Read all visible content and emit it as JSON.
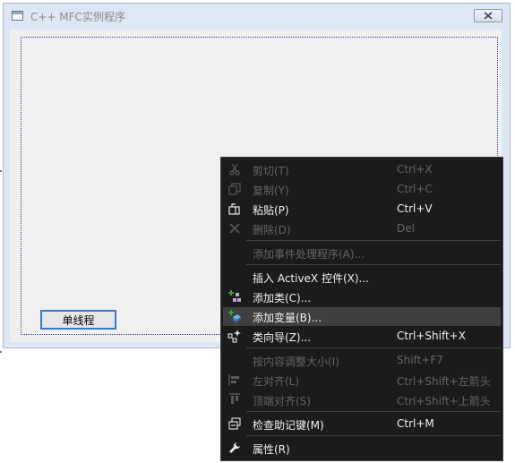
{
  "dialog": {
    "title": "C++ MFC实例程序",
    "button_label": "单线程"
  },
  "menu": {
    "items": [
      {
        "label": "剪切(T)",
        "shortcut": "Ctrl+X",
        "enabled": false,
        "icon": "scissors-icon"
      },
      {
        "label": "复制(Y)",
        "shortcut": "Ctrl+C",
        "enabled": false,
        "icon": "copy-icon"
      },
      {
        "label": "粘贴(P)",
        "shortcut": "Ctrl+V",
        "enabled": true,
        "icon": "paste-icon"
      },
      {
        "label": "删除(D)",
        "shortcut": "Del",
        "enabled": false,
        "icon": "delete-icon"
      },
      {
        "label": "添加事件处理程序(A)...",
        "shortcut": "",
        "enabled": false,
        "icon": ""
      },
      {
        "label": "插入 ActiveX 控件(X)...",
        "shortcut": "",
        "enabled": true,
        "icon": ""
      },
      {
        "label": "添加类(C)...",
        "shortcut": "",
        "enabled": true,
        "icon": "add-class-icon"
      },
      {
        "label": "添加变量(B)...",
        "shortcut": "",
        "enabled": true,
        "icon": "add-variable-icon",
        "highlighted": true
      },
      {
        "label": "类向导(Z)...",
        "shortcut": "Ctrl+Shift+X",
        "enabled": true,
        "icon": "class-wizard-icon"
      },
      {
        "label": "按内容调整大小(I)",
        "shortcut": "Shift+F7",
        "enabled": false,
        "icon": ""
      },
      {
        "label": "左对齐(L)",
        "shortcut": "Ctrl+Shift+左箭头",
        "enabled": false,
        "icon": "align-left-icon"
      },
      {
        "label": "顶端对齐(S)",
        "shortcut": "Ctrl+Shift+上箭头",
        "enabled": false,
        "icon": "align-top-icon"
      },
      {
        "label": "检查助记键(M)",
        "shortcut": "Ctrl+M",
        "enabled": true,
        "icon": "check-mnemonics-icon"
      },
      {
        "label": "属性(R)",
        "shortcut": "",
        "enabled": true,
        "icon": "wrench-icon"
      }
    ]
  },
  "colors": {
    "menu_bg": "#1b1b1c",
    "menu_text": "#f1f1f1",
    "menu_disabled_text": "#656565",
    "menu_highlight": "#3f3f40",
    "accent_green": "#3fa63f"
  }
}
